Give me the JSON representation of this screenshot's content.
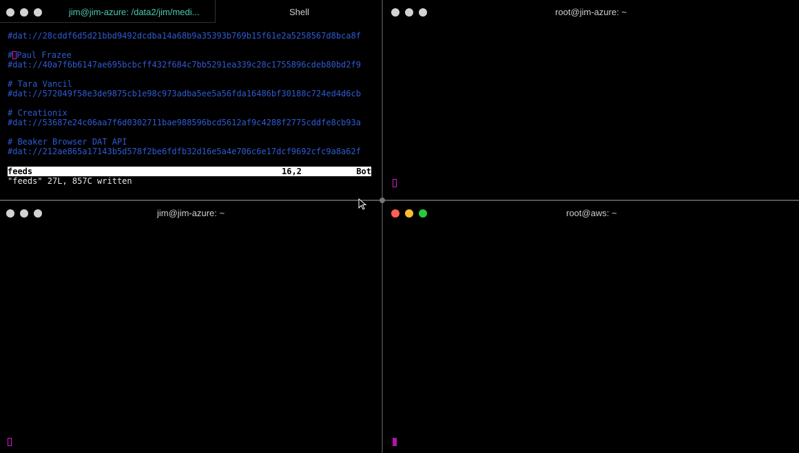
{
  "panes": {
    "top_left": {
      "tab_active": "jim@jim-azure: /data2/jim/medi...",
      "tab_other": "Shell",
      "lines": [
        {
          "text": "#dat://28cddf6d5d21bbd9492dcdba14a68b9a35393b769b15f61e2a5258567d8bca8f"
        },
        {
          "text": ""
        },
        {
          "text": "# Paul Frazee"
        },
        {
          "text": "#dat://40a7f6b6147ae695bcbcff432f684c7bb5291ea339c28c1755896cdeb80bd2f9"
        },
        {
          "text": ""
        },
        {
          "text": "# Tara Vancil"
        },
        {
          "text": "#dat://572049f58e3de9875cb1e98c973adba5ee5a56fda16486bf30188c724ed4d6cb"
        },
        {
          "text": ""
        },
        {
          "text": "# Creationix"
        },
        {
          "text": "#dat://53687e24c06aa7f6d0302711bae988596bcd5612af9c4288f2775cddfe8cb93a"
        },
        {
          "text": ""
        },
        {
          "text": "# Beaker Browser DAT API"
        },
        {
          "text": "#dat://212ae865a17143b5d578f2be6fdfb32d16e5a4e706c6e17dcf9692cfc9a8a62f"
        }
      ],
      "status": {
        "file": "feeds",
        "position": "16,2",
        "scroll": "Bot"
      },
      "message": "\"feeds\" 27L, 857C written"
    },
    "top_right": {
      "title": "root@jim-azure: ~"
    },
    "bottom_left": {
      "title": "jim@jim-azure: ~"
    },
    "bottom_right": {
      "title": "root@aws: ~"
    }
  },
  "colors": {
    "text_blue": "#2f5bd3",
    "cursor": "#d21ccf"
  }
}
